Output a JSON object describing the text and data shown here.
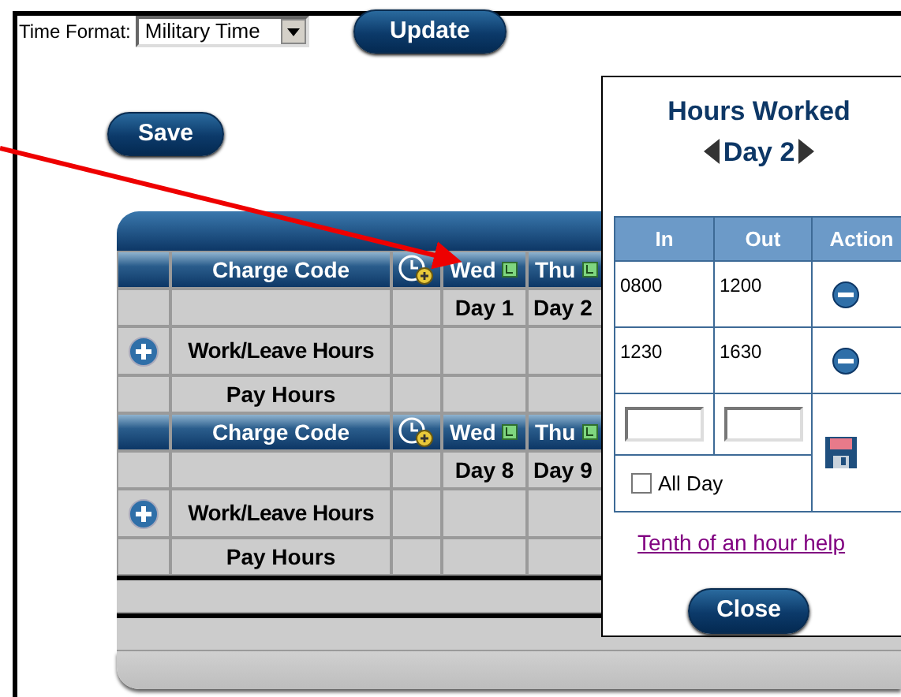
{
  "time_format": {
    "label": "Time Format:",
    "value": "Military Time"
  },
  "update_button": "Update",
  "save_button": "Save",
  "timesheet": {
    "sections": [
      {
        "columns": [
          {
            "kind": "blank"
          },
          {
            "kind": "text",
            "label": "Charge Code"
          },
          {
            "kind": "clock"
          },
          {
            "kind": "day",
            "label": "Wed"
          },
          {
            "kind": "day",
            "label": "Thu"
          }
        ],
        "days": [
          "Day 1",
          "Day 2"
        ],
        "work_label": "Work/Leave Hours",
        "pay_label": "Pay Hours"
      },
      {
        "columns": [
          {
            "kind": "blank"
          },
          {
            "kind": "text",
            "label": "Charge Code"
          },
          {
            "kind": "clock"
          },
          {
            "kind": "day",
            "label": "Wed"
          },
          {
            "kind": "day",
            "label": "Thu"
          }
        ],
        "days": [
          "Day 8",
          "Day 9"
        ],
        "work_label": "Work/Leave Hours",
        "pay_label": "Pay Hours"
      }
    ]
  },
  "popup": {
    "title": "Hours Worked",
    "day": "Day 2",
    "columns": [
      "In",
      "Out",
      "Action"
    ],
    "entries": [
      {
        "in": "0800",
        "out": "1200"
      },
      {
        "in": "1230",
        "out": "1630"
      }
    ],
    "all_day": {
      "label": "All Day",
      "checked": false
    },
    "help_link": "Tenth of an hour help",
    "close_button": "Close"
  }
}
